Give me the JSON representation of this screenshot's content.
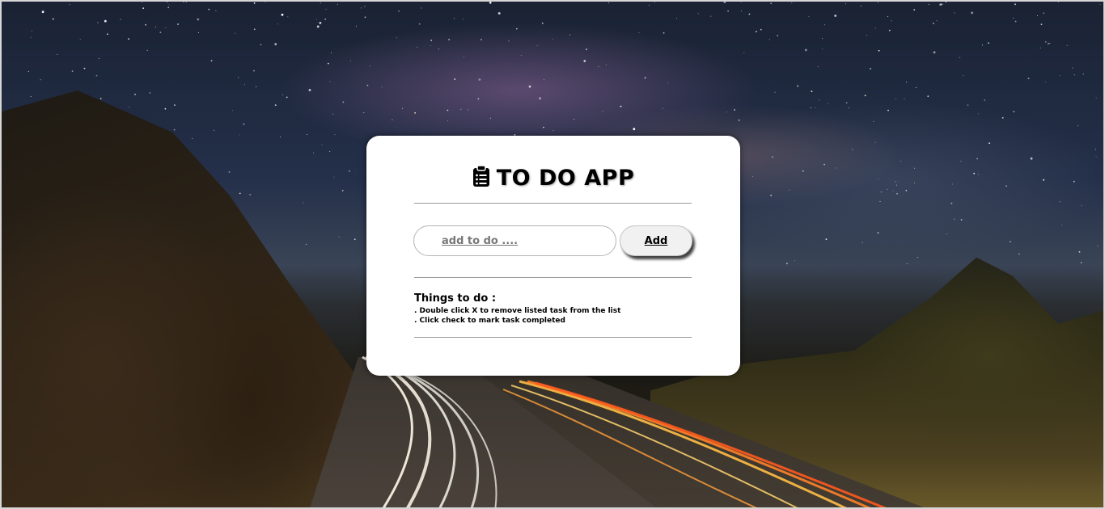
{
  "app": {
    "title": "TO DO APP",
    "title_icon": "clipboard-list-icon"
  },
  "form": {
    "input_placeholder": "add to do ....",
    "input_value": "",
    "add_label": "Add"
  },
  "instructions": {
    "heading": "Things to do :",
    "lines": [
      ". Double click X to remove listed task from the list",
      ". Click check to mark task completed"
    ]
  },
  "colors": {
    "card_background": "#ffffff",
    "text": "#000000",
    "divider": "#9a9a9a",
    "button_background": "#f1f1f1"
  }
}
